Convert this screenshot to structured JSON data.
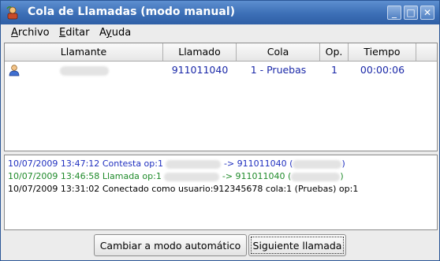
{
  "window": {
    "title": "Cola de Llamadas (modo manual)",
    "controls": {
      "minimize": "_",
      "maximize": "□",
      "close": "✕"
    }
  },
  "menu": [
    {
      "pre": "",
      "u": "A",
      "post": "rchivo"
    },
    {
      "pre": "",
      "u": "E",
      "post": "ditar"
    },
    {
      "pre": "A",
      "u": "y",
      "post": "uda"
    }
  ],
  "table": {
    "columns": [
      "Llamante",
      "Llamado",
      "Cola",
      "Op.",
      "Tiempo"
    ],
    "rows": [
      {
        "llamante": "",
        "llamado": "911011040",
        "cola": "1 - Pruebas",
        "op": "1",
        "tiempo": "00:00:06"
      }
    ]
  },
  "log": [
    {
      "date": "10/07/2009 13:47:12",
      "text_before": "Contesta op:1",
      "text_after": "-> 911011040 (",
      "text_end": ")",
      "color": "#1f2fbf"
    },
    {
      "date": "10/07/2009 13:46:58",
      "text_before": "Llamada op:1",
      "text_after": "-> 911011040 (",
      "text_end": ")",
      "color": "#1f8a2a"
    },
    {
      "date": "10/07/2009 13:31:02",
      "text_before": "Conectado como usuario:912345678 cola:1 (Pruebas) op:1",
      "text_after": "",
      "text_end": "",
      "color": "#000000"
    }
  ],
  "buttons": {
    "auto": "Cambiar a modo automático",
    "next": "Siguiente llamada"
  }
}
